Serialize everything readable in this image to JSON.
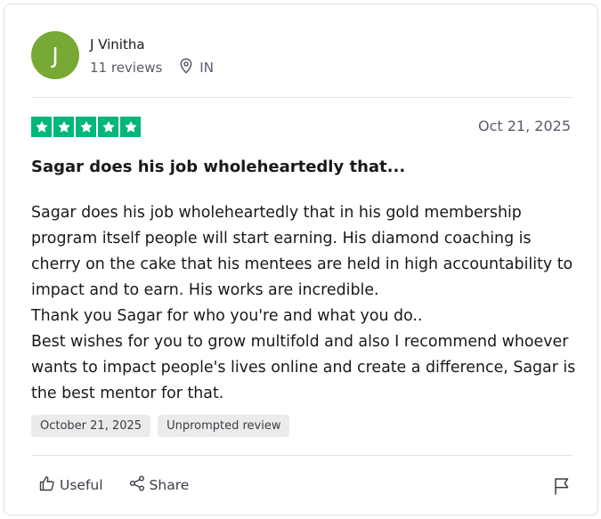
{
  "reviewer": {
    "initial": "J",
    "name": "J Vinitha",
    "reviews_count": "11 reviews",
    "location": "IN",
    "avatar_color": "#78a934",
    "location_icon": "location-pin-icon"
  },
  "review": {
    "rating": 5,
    "rating_max": 5,
    "star_color": "#00b67a",
    "date": "Oct 21, 2025",
    "title": "Sagar does his job wholeheartedly that...",
    "body": "Sagar does his job wholeheartedly that in his gold membership program itself people will start earning. His diamond coaching is cherry on the cake that his mentees are held in high accountability to impact and to earn. His works are incredible.\nThank you Sagar for who you're and what you do..\nBest wishes for you to grow multifold and also I recommend whoever wants to impact people's lives online and create a difference, Sagar is the best mentor for that.",
    "tags": [
      "October 21, 2025",
      "Unprompted review"
    ]
  },
  "actions": {
    "useful_label": "Useful",
    "useful_icon": "thumbs-up-icon",
    "share_label": "Share",
    "share_icon": "share-icon",
    "report_icon": "flag-icon"
  }
}
